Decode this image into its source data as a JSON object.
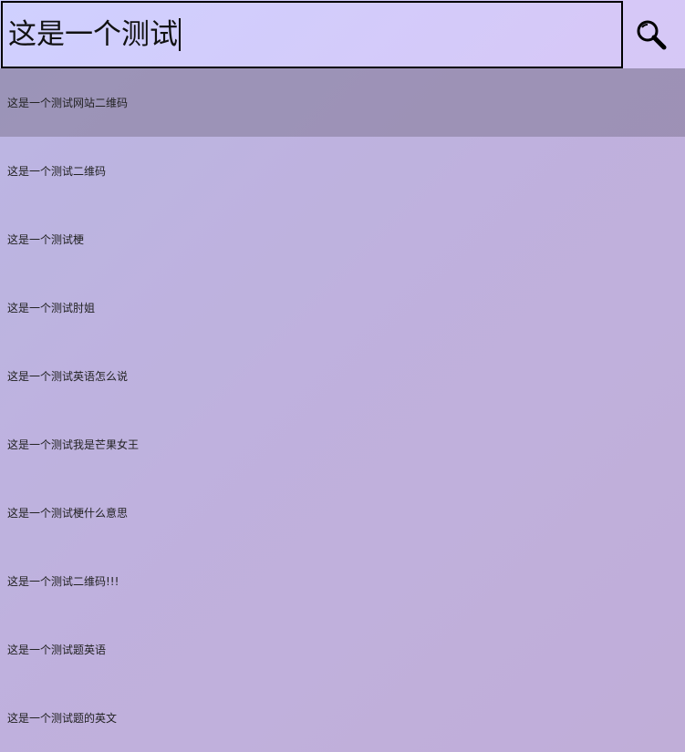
{
  "search": {
    "query": "这是一个测试"
  },
  "suggestions": [
    "这是一个测试网站二维码",
    "这是一个测试二维码",
    "这是一个测试梗",
    "这是一个测试肘姐",
    "这是一个测试英语怎么说",
    "这是一个测试我是芒果女王",
    "这是一个测试梗什么意思",
    "这是一个测试二维码!!!",
    "这是一个测试题英语",
    "这是一个测试题的英文"
  ],
  "icons": {
    "search_button": "search-icon"
  },
  "colors": {
    "highlight": "#a69cbd",
    "border": "#000000"
  }
}
